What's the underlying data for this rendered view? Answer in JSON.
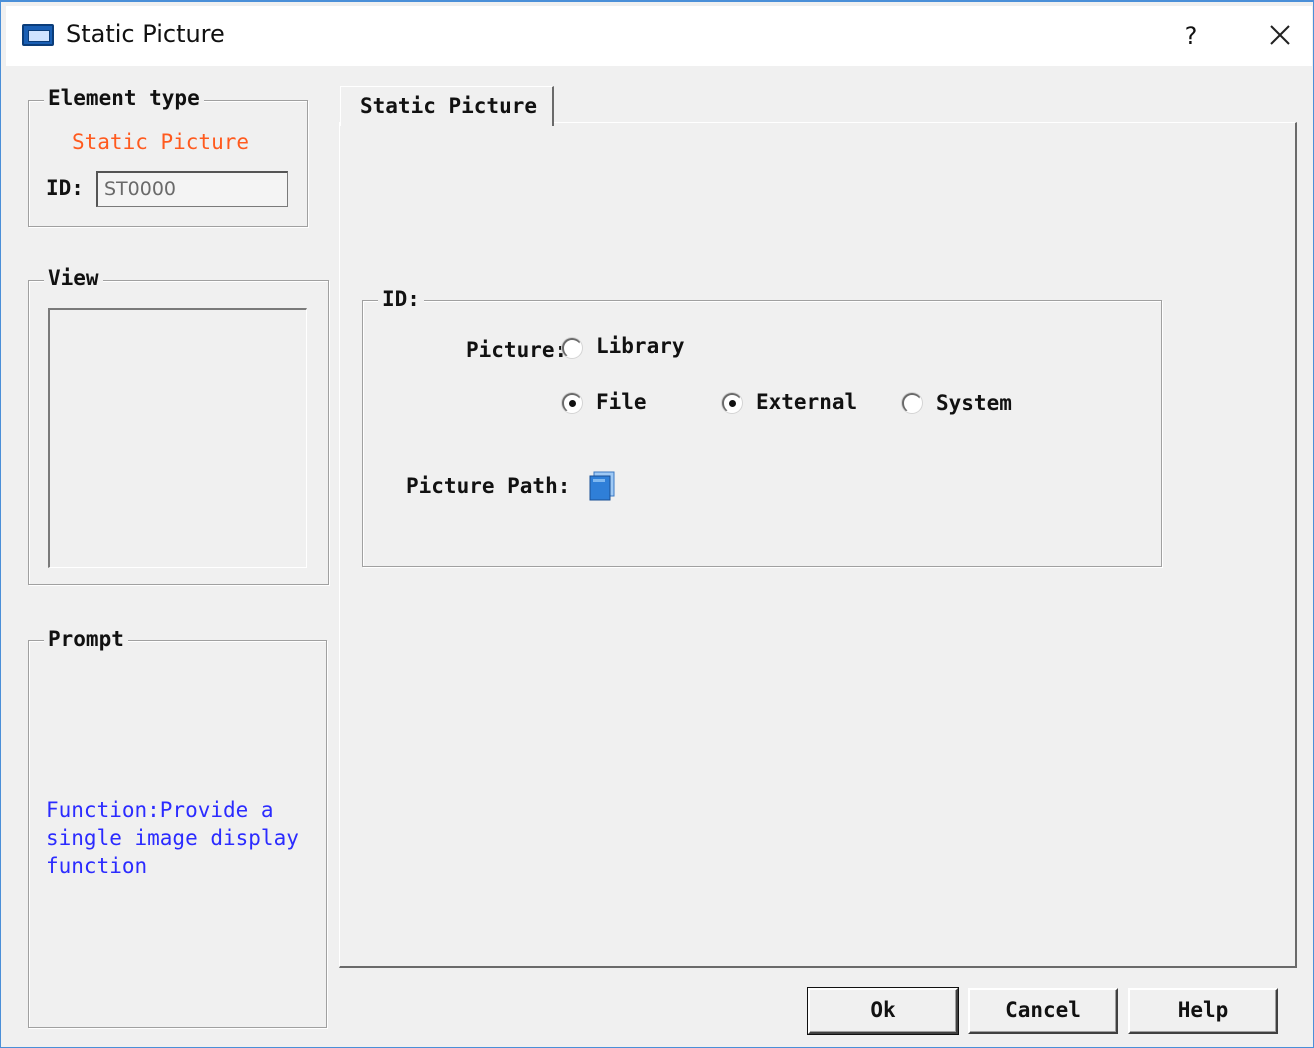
{
  "window": {
    "title": "Static Picture",
    "help_glyph": "?",
    "close_glyph": "✕",
    "icon": "app-icon"
  },
  "element_type": {
    "legend": "Element type",
    "value": "Static Picture",
    "id_label": "ID:",
    "id_value": "ST0000",
    "value_color": "#ff5a1e"
  },
  "view": {
    "legend": "View"
  },
  "prompt": {
    "legend": "Prompt",
    "text": "Function:Provide a single image display function",
    "text_color": "#2b2bff"
  },
  "tabs": [
    {
      "label": "Static Picture",
      "selected": true
    }
  ],
  "id_group": {
    "legend": "ID:",
    "picture_label": "Picture:",
    "radios": {
      "library": {
        "label": "Library",
        "checked": false
      },
      "file": {
        "label": "File",
        "checked": true
      },
      "external": {
        "label": "External",
        "checked": true
      },
      "system": {
        "label": "System",
        "checked": false
      }
    },
    "picture_path_label": "Picture Path:",
    "browse_icon": "folder-icon"
  },
  "buttons": {
    "ok": "Ok",
    "cancel": "Cancel",
    "help": "Help"
  }
}
